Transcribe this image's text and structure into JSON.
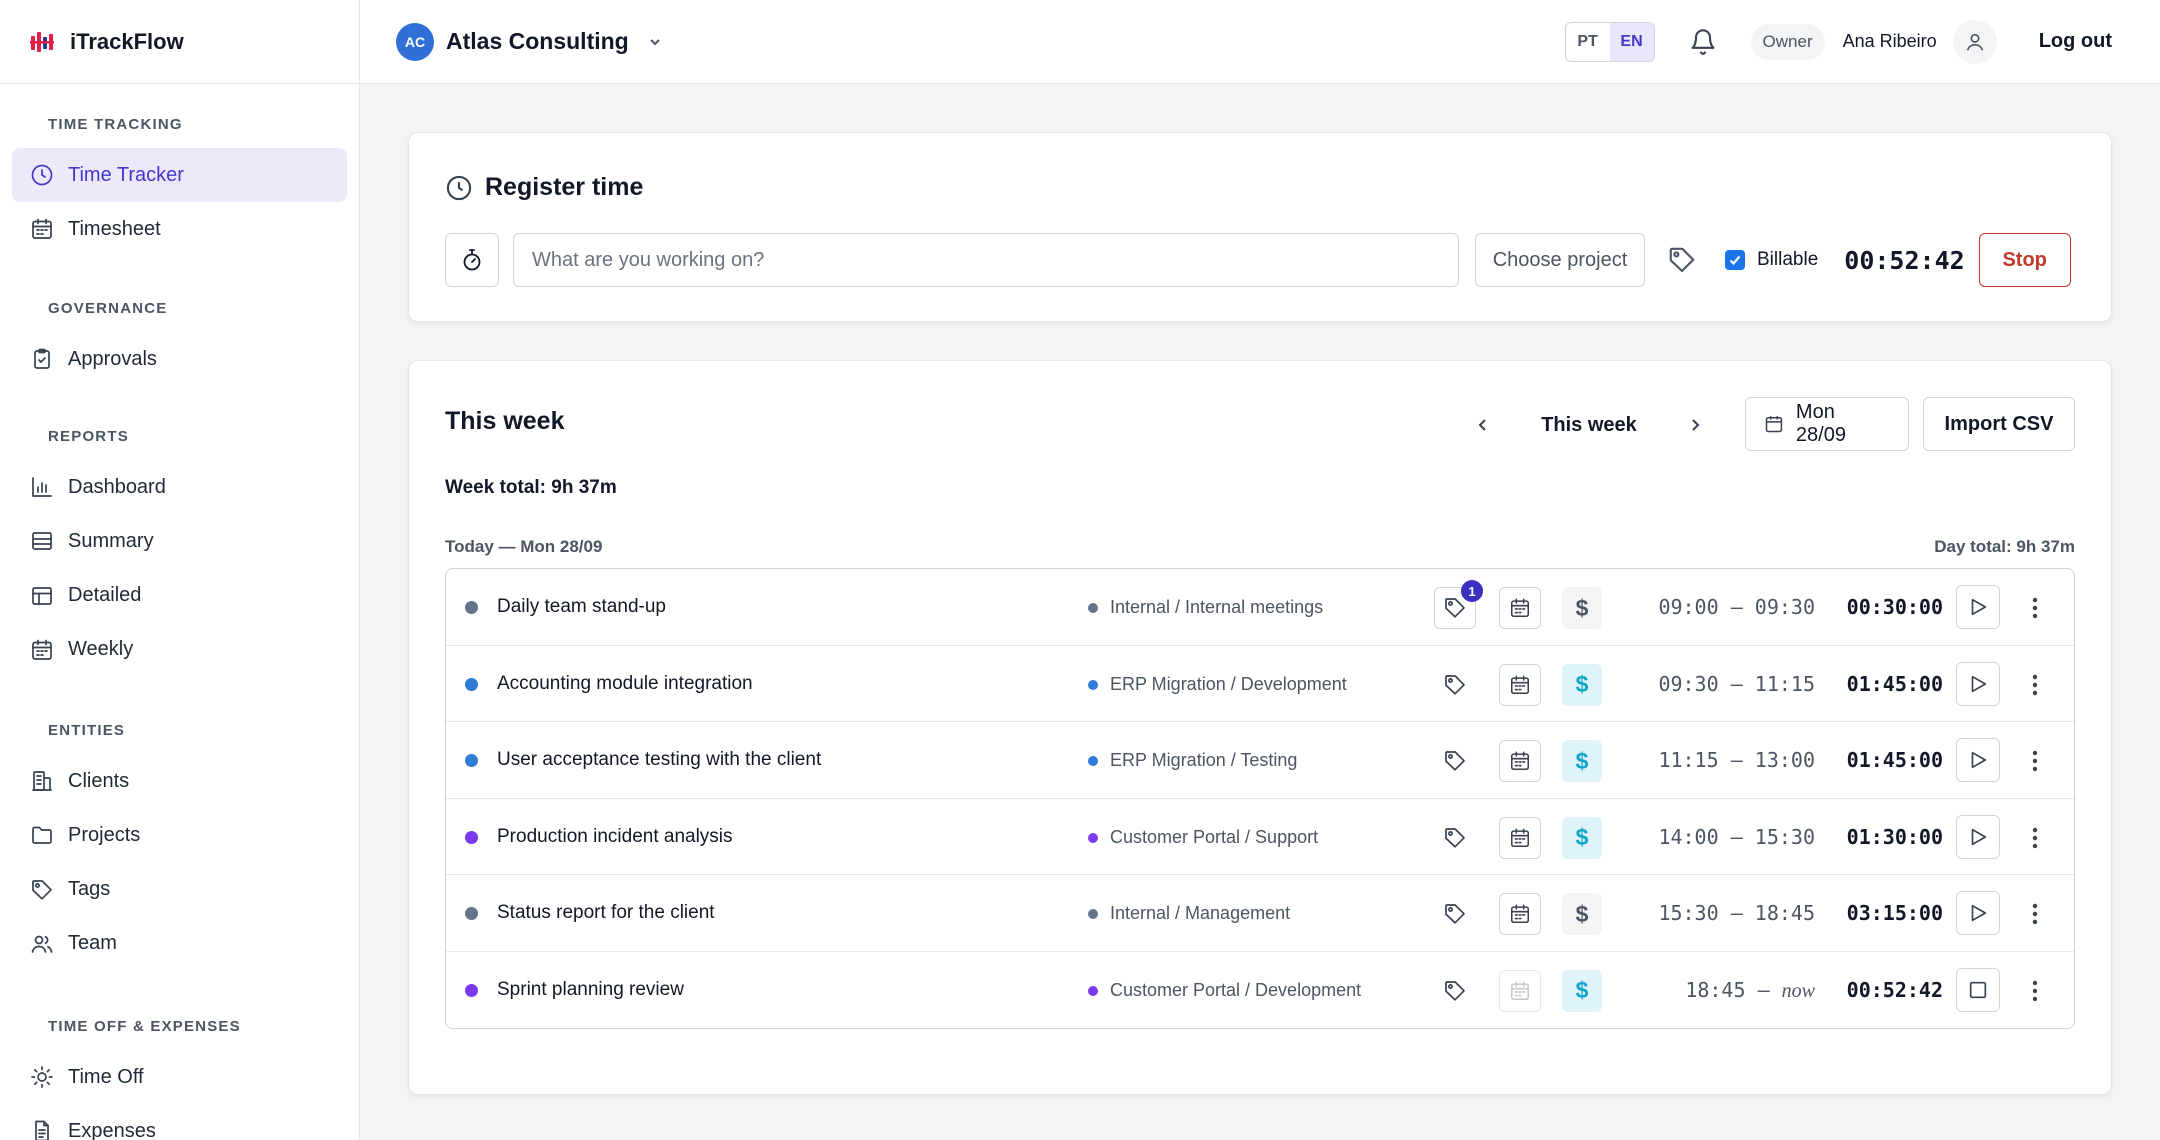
{
  "app": {
    "name": "iTrackFlow"
  },
  "sidebar": {
    "sections": [
      {
        "title": "TIME TRACKING",
        "items": [
          {
            "label": "Time Tracker",
            "icon": "clock-icon",
            "active": true
          },
          {
            "label": "Timesheet",
            "icon": "calendar-icon"
          }
        ]
      },
      {
        "title": "GOVERNANCE",
        "items": [
          {
            "label": "Approvals",
            "icon": "clipboard-check-icon"
          }
        ]
      },
      {
        "title": "REPORTS",
        "items": [
          {
            "label": "Dashboard",
            "icon": "bar-chart-icon"
          },
          {
            "label": "Summary",
            "icon": "list-icon"
          },
          {
            "label": "Detailed",
            "icon": "table-icon"
          },
          {
            "label": "Weekly",
            "icon": "calendar-icon"
          }
        ]
      },
      {
        "title": "ENTITIES",
        "items": [
          {
            "label": "Clients",
            "icon": "building-icon"
          },
          {
            "label": "Projects",
            "icon": "folder-icon"
          },
          {
            "label": "Tags",
            "icon": "tag-icon"
          },
          {
            "label": "Team",
            "icon": "users-icon"
          }
        ]
      },
      {
        "title": "TIME OFF & EXPENSES",
        "items": [
          {
            "label": "Time Off",
            "icon": "sun-icon"
          },
          {
            "label": "Expenses",
            "icon": "receipt-icon"
          }
        ]
      }
    ]
  },
  "header": {
    "org_initials": "AC",
    "org_name": "Atlas Consulting",
    "languages": [
      "PT",
      "EN"
    ],
    "active_language": "EN",
    "role": "Owner",
    "user_name": "Ana Ribeiro",
    "logout": "Log out"
  },
  "register": {
    "title": "Register time",
    "placeholder": "What are you working on?",
    "project_button": "Choose project",
    "billable_label": "Billable",
    "billable_checked": true,
    "elapsed": "00:52:42",
    "stop_label": "Stop"
  },
  "week": {
    "title": "This week",
    "nav_label": "This week",
    "date_button": "Mon 28/09",
    "import_label": "Import CSV",
    "week_total": "Week total: 9h 37m",
    "day_label": "Today — Mon 28/09",
    "day_total": "Day total: 9h 37m",
    "entries": [
      {
        "description": "Daily team stand-up",
        "project": "Internal / Internal meetings",
        "color": "#64748b",
        "tag_count": "1",
        "billable": false,
        "start": "09:00",
        "end": "09:30",
        "duration": "00:30:00",
        "running": false
      },
      {
        "description": "Accounting module integration",
        "project": "ERP Migration / Development",
        "color": "#2f7bd6",
        "tag_count": "",
        "billable": true,
        "start": "09:30",
        "end": "11:15",
        "duration": "01:45:00",
        "running": false
      },
      {
        "description": "User acceptance testing with the client",
        "project": "ERP Migration / Testing",
        "color": "#2f7bd6",
        "tag_count": "",
        "billable": true,
        "start": "11:15",
        "end": "13:00",
        "duration": "01:45:00",
        "running": false
      },
      {
        "description": "Production incident analysis",
        "project": "Customer Portal / Support",
        "color": "#7c3aed",
        "tag_count": "",
        "billable": true,
        "start": "14:00",
        "end": "15:30",
        "duration": "01:30:00",
        "running": false
      },
      {
        "description": "Status report for the client",
        "project": "Internal / Management",
        "color": "#64748b",
        "tag_count": "",
        "billable": false,
        "start": "15:30",
        "end": "18:45",
        "duration": "03:15:00",
        "running": false
      },
      {
        "description": "Sprint planning review",
        "project": "Customer Portal / Development",
        "color": "#7c3aed",
        "tag_count": "",
        "billable": true,
        "start": "18:45",
        "end": "now",
        "duration": "00:52:42",
        "running": true
      }
    ]
  },
  "colors": {
    "accent": "#4338ca",
    "accent_bg": "#ede9fb",
    "stop": "#c0392b",
    "billable_on": "#0ea5c9"
  }
}
